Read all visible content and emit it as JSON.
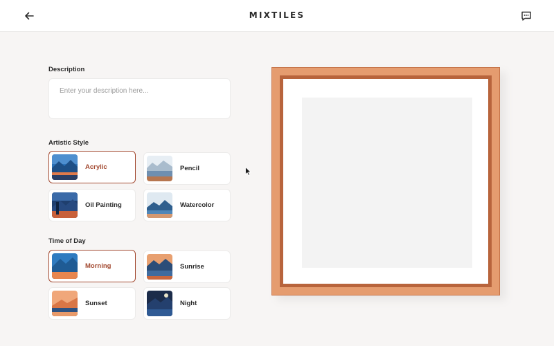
{
  "header": {
    "title": "MIXTILES",
    "back_icon": "arrow-left-icon",
    "chat_icon": "chat-icon"
  },
  "description": {
    "label": "Description",
    "placeholder": "Enter your description here...",
    "value": ""
  },
  "artistic_style": {
    "label": "Artistic Style",
    "options": [
      {
        "label": "Acrylic",
        "selected": true
      },
      {
        "label": "Pencil",
        "selected": false
      },
      {
        "label": "Oil Painting",
        "selected": false
      },
      {
        "label": "Watercolor",
        "selected": false
      }
    ]
  },
  "time_of_day": {
    "label": "Time of Day",
    "options": [
      {
        "label": "Morning",
        "selected": true
      },
      {
        "label": "Sunrise",
        "selected": false
      },
      {
        "label": "Sunset",
        "selected": false
      },
      {
        "label": "Night",
        "selected": false
      }
    ]
  },
  "colors": {
    "accent": "#a34a31",
    "frame": "#e59c6f",
    "background": "#f7f5f4"
  }
}
